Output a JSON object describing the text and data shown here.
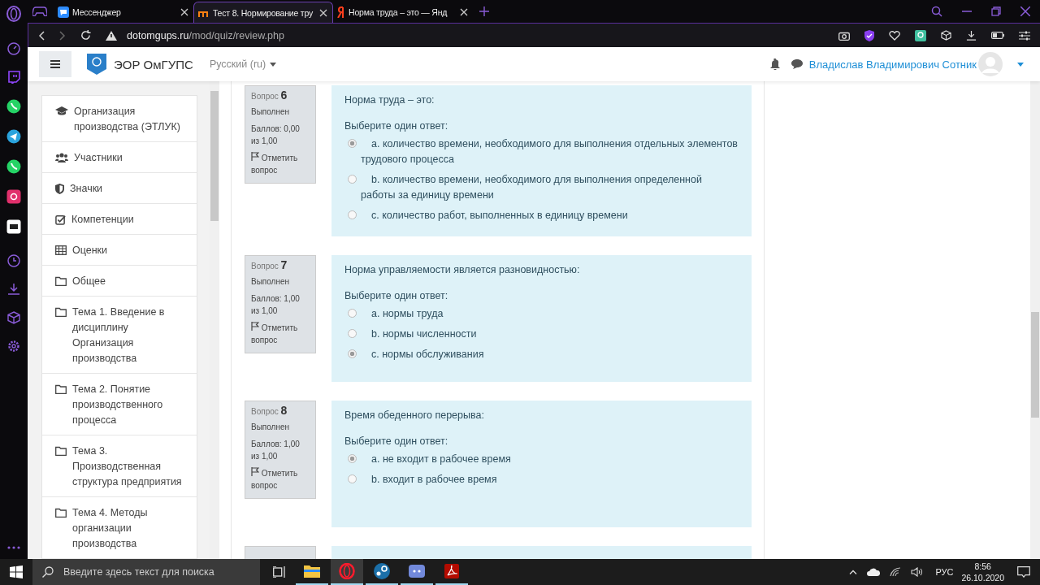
{
  "browser": {
    "tabs": [
      {
        "title": "Мессенджер",
        "kind": "messenger",
        "selected": false
      },
      {
        "title": "Тест 8. Нормирование тру",
        "kind": "moodle",
        "selected": true
      },
      {
        "title": "Норма труда – это — Янд",
        "kind": "yandex",
        "selected": false
      }
    ],
    "address": {
      "domain": "dotomgups.ru",
      "path": "/mod/quiz/review.php"
    }
  },
  "site": {
    "name": "ЭОР ОмГУПС",
    "language": "Русский (ru)",
    "user": "Владислав Владимирович Сотник"
  },
  "nav_drawer": {
    "items": [
      {
        "kind": "course",
        "label": "Организация производства (ЭТЛУК)"
      },
      {
        "kind": "participants",
        "label": "Участники"
      },
      {
        "kind": "badges",
        "label": "Значки"
      },
      {
        "kind": "competencies",
        "label": "Компетенции"
      },
      {
        "kind": "grades",
        "label": "Оценки"
      },
      {
        "kind": "section",
        "label": "Общее"
      },
      {
        "kind": "section",
        "label": "Тема 1. Введение в дисциплину Организация производства"
      },
      {
        "kind": "section",
        "label": "Тема 2. Понятие производственного процесса"
      },
      {
        "kind": "section",
        "label": "Тема 3. Производственная структура предприятия"
      },
      {
        "kind": "section",
        "label": "Тема 4. Методы организации производства"
      }
    ]
  },
  "questions": [
    {
      "label": "Вопрос",
      "number": "6",
      "state": "Выполнен",
      "score": "Баллов: 0,00 из 1,00",
      "flag": "Отметить вопрос",
      "text": "Норма труда – это:",
      "prompt": "Выберите один ответ:",
      "answers": [
        {
          "text": "a. количество времени, необходимого для выполнения отдельных элементов трудового процесса",
          "selected": true
        },
        {
          "text": "b. количество времени, необходимого для выполнения определенной работы за единицу времени",
          "selected": false
        },
        {
          "text": "c. количество работ, выполненных в единицу времени",
          "selected": false
        }
      ]
    },
    {
      "label": "Вопрос",
      "number": "7",
      "state": "Выполнен",
      "score": "Баллов: 1,00 из 1,00",
      "flag": "Отметить вопрос",
      "text": "Норма управляемости является разновидностью:",
      "prompt": "Выберите один ответ:",
      "answers": [
        {
          "text": "a. нормы труда",
          "selected": false
        },
        {
          "text": "b. нормы численности",
          "selected": false
        },
        {
          "text": "c. нормы обслуживания",
          "selected": true
        }
      ]
    },
    {
      "label": "Вопрос",
      "number": "8",
      "state": "Выполнен",
      "score": "Баллов: 1,00 из 1,00",
      "flag": "Отметить вопрос",
      "text": "Время обеденного перерыва:",
      "prompt": "Выберите один ответ:",
      "answers": [
        {
          "text": "a. не входит в рабочее время",
          "selected": true
        },
        {
          "text": "b. входит в рабочее время",
          "selected": false
        }
      ]
    }
  ],
  "taskbar": {
    "search_placeholder": "Введите здесь текст для поиска",
    "language": "РУС",
    "time": "8:56",
    "date": "26.10.2020"
  }
}
